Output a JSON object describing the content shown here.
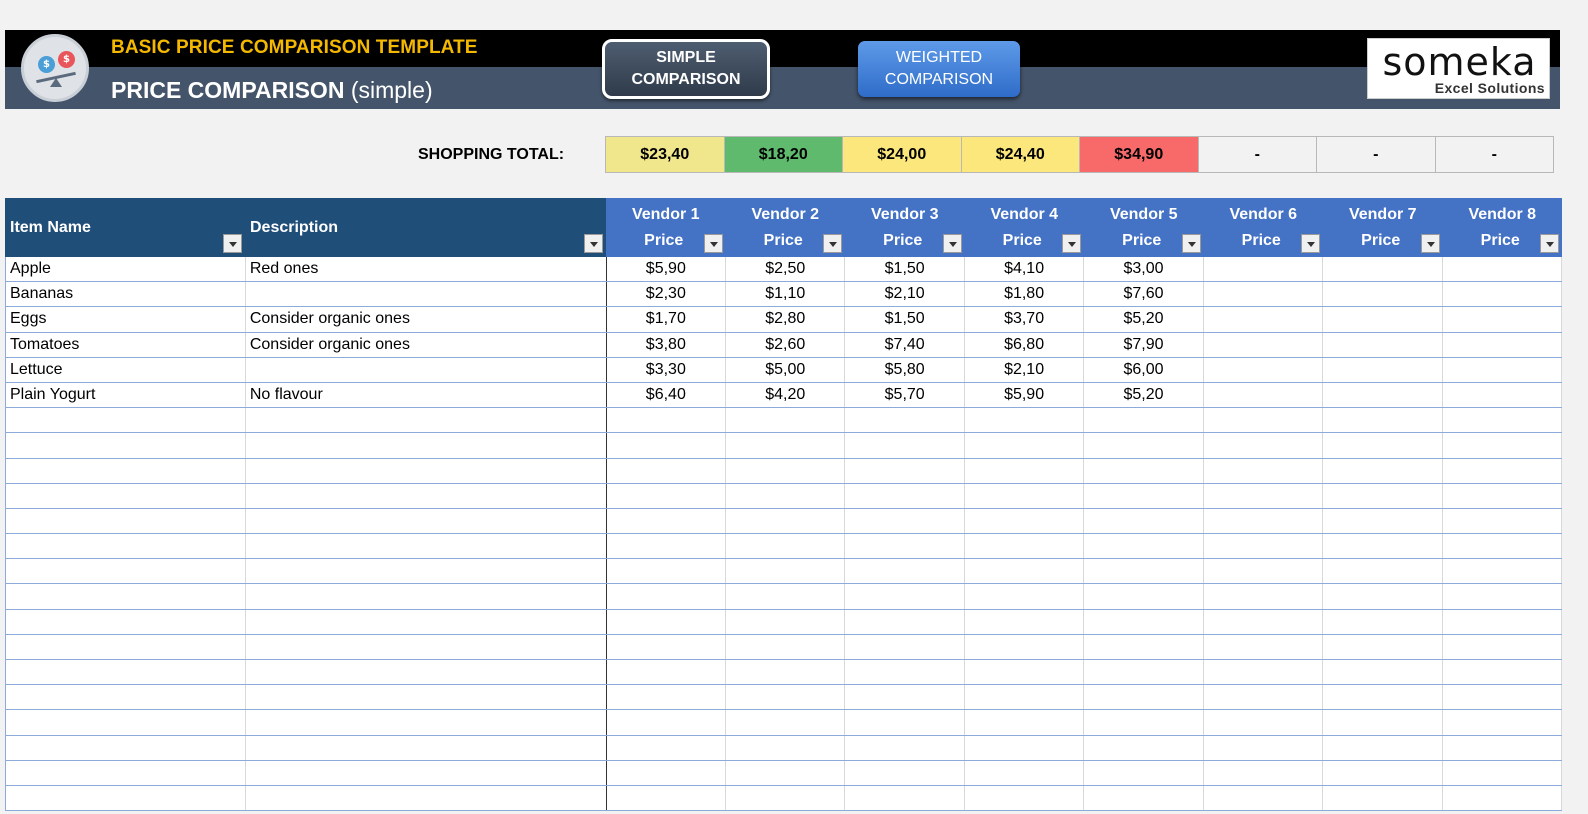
{
  "header": {
    "title": "BASIC PRICE COMPARISON TEMPLATE",
    "subtitle": "PRICE COMPARISON",
    "subtitle_paren": "(simple)",
    "btn_simple_l1": "SIMPLE",
    "btn_simple_l2": "COMPARISON",
    "btn_weighted_l1": "WEIGHTED",
    "btn_weighted_l2": "COMPARISON",
    "brand_name": "someka",
    "brand_tag": "Excel Solutions"
  },
  "totals": {
    "label": "SHOPPING TOTAL:",
    "values": [
      "$23,40",
      "$18,20",
      "$24,00",
      "$24,40",
      "$34,90",
      "-",
      "-",
      "-"
    ],
    "colors": [
      "#f0e68c",
      "#5fba6e",
      "#fbe77c",
      "#fbe77c",
      "#f86a6a",
      "#f2f2f2",
      "#f2f2f2",
      "#f2f2f2"
    ]
  },
  "table": {
    "col_item": "Item Name",
    "col_desc": "Description",
    "price_label": "Price",
    "vendors": [
      "Vendor 1",
      "Vendor 2",
      "Vendor 3",
      "Vendor 4",
      "Vendor 5",
      "Vendor 6",
      "Vendor 7",
      "Vendor 8"
    ],
    "rows": [
      {
        "name": "Apple",
        "desc": "Red ones",
        "prices": [
          "$5,90",
          "$2,50",
          "$1,50",
          "$4,10",
          "$3,00",
          "",
          "",
          ""
        ]
      },
      {
        "name": "Bananas",
        "desc": "",
        "prices": [
          "$2,30",
          "$1,10",
          "$2,10",
          "$1,80",
          "$7,60",
          "",
          "",
          ""
        ]
      },
      {
        "name": "Eggs",
        "desc": "Consider organic ones",
        "prices": [
          "$1,70",
          "$2,80",
          "$1,50",
          "$3,70",
          "$5,20",
          "",
          "",
          ""
        ]
      },
      {
        "name": "Tomatoes",
        "desc": "Consider organic ones",
        "prices": [
          "$3,80",
          "$2,60",
          "$7,40",
          "$6,80",
          "$7,90",
          "",
          "",
          ""
        ]
      },
      {
        "name": "Lettuce",
        "desc": "",
        "prices": [
          "$3,30",
          "$5,00",
          "$5,80",
          "$2,10",
          "$6,00",
          "",
          "",
          ""
        ]
      },
      {
        "name": "Plain Yogurt",
        "desc": "No flavour",
        "prices": [
          "$6,40",
          "$4,20",
          "$5,70",
          "$5,90",
          "$5,20",
          "",
          "",
          ""
        ]
      },
      {
        "name": "",
        "desc": "",
        "prices": [
          "",
          "",
          "",
          "",
          "",
          "",
          "",
          ""
        ]
      },
      {
        "name": "",
        "desc": "",
        "prices": [
          "",
          "",
          "",
          "",
          "",
          "",
          "",
          ""
        ]
      },
      {
        "name": "",
        "desc": "",
        "prices": [
          "",
          "",
          "",
          "",
          "",
          "",
          "",
          ""
        ]
      },
      {
        "name": "",
        "desc": "",
        "prices": [
          "",
          "",
          "",
          "",
          "",
          "",
          "",
          ""
        ]
      },
      {
        "name": "",
        "desc": "",
        "prices": [
          "",
          "",
          "",
          "",
          "",
          "",
          "",
          ""
        ]
      },
      {
        "name": "",
        "desc": "",
        "prices": [
          "",
          "",
          "",
          "",
          "",
          "",
          "",
          ""
        ]
      },
      {
        "name": "",
        "desc": "",
        "prices": [
          "",
          "",
          "",
          "",
          "",
          "",
          "",
          ""
        ]
      },
      {
        "name": "",
        "desc": "",
        "prices": [
          "",
          "",
          "",
          "",
          "",
          "",
          "",
          ""
        ]
      },
      {
        "name": "",
        "desc": "",
        "prices": [
          "",
          "",
          "",
          "",
          "",
          "",
          "",
          ""
        ]
      },
      {
        "name": "",
        "desc": "",
        "prices": [
          "",
          "",
          "",
          "",
          "",
          "",
          "",
          ""
        ]
      },
      {
        "name": "",
        "desc": "",
        "prices": [
          "",
          "",
          "",
          "",
          "",
          "",
          "",
          ""
        ]
      },
      {
        "name": "",
        "desc": "",
        "prices": [
          "",
          "",
          "",
          "",
          "",
          "",
          "",
          ""
        ]
      },
      {
        "name": "",
        "desc": "",
        "prices": [
          "",
          "",
          "",
          "",
          "",
          "",
          "",
          ""
        ]
      },
      {
        "name": "",
        "desc": "",
        "prices": [
          "",
          "",
          "",
          "",
          "",
          "",
          "",
          ""
        ]
      },
      {
        "name": "",
        "desc": "",
        "prices": [
          "",
          "",
          "",
          "",
          "",
          "",
          "",
          ""
        ]
      },
      {
        "name": "",
        "desc": "",
        "prices": [
          "",
          "",
          "",
          "",
          "",
          "",
          "",
          ""
        ]
      }
    ]
  }
}
